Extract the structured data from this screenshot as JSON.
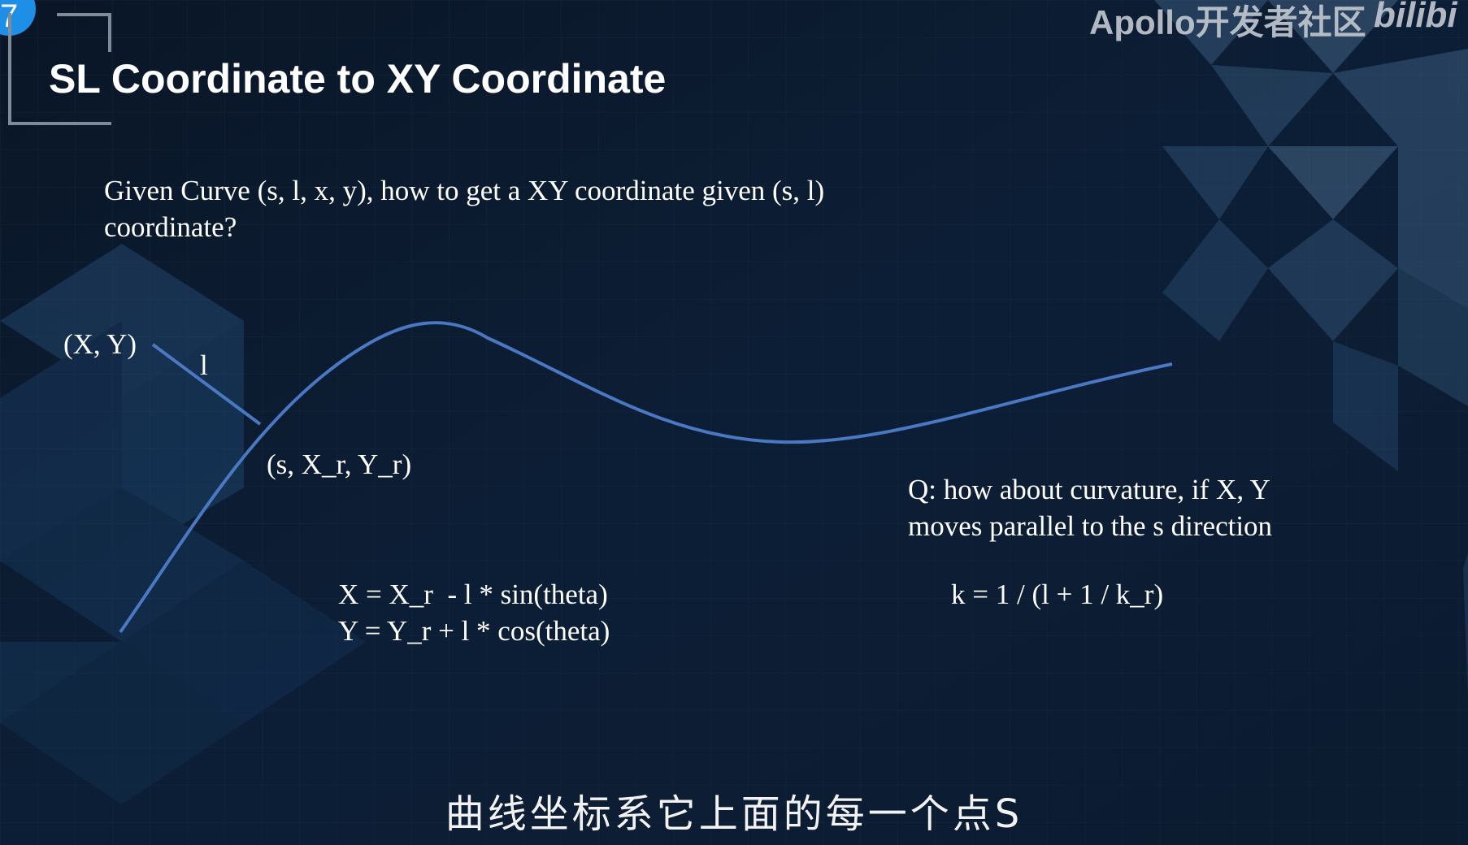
{
  "slide": {
    "number": "7",
    "title": "SL Coordinate to XY Coordinate"
  },
  "watermark": {
    "brand": "Apollo开发者社区",
    "platform": "bilibi"
  },
  "content": {
    "question": "Given Curve (s, l, x, y), how to get a XY coordinate given (s, l) coordinate?",
    "point_xy_label": "(X, Y)",
    "offset_label": "l",
    "ref_point_label": "(s, X_r, Y_r)",
    "formula_x": "X = X_r  - l * sin(theta)",
    "formula_y": "Y = Y_r + l * cos(theta)",
    "curvature_question_line1": "Q: how about curvature, if X, Y",
    "curvature_question_line2": "moves parallel to the s direction",
    "curvature_formula": "k = 1 / (l + 1 / k_r)"
  },
  "subtitle": "曲线坐标系它上面的每一个点S",
  "colors": {
    "background": "#0b1a2e",
    "curve": "#4a78c2",
    "accent_badge": "#1e8fe6"
  }
}
